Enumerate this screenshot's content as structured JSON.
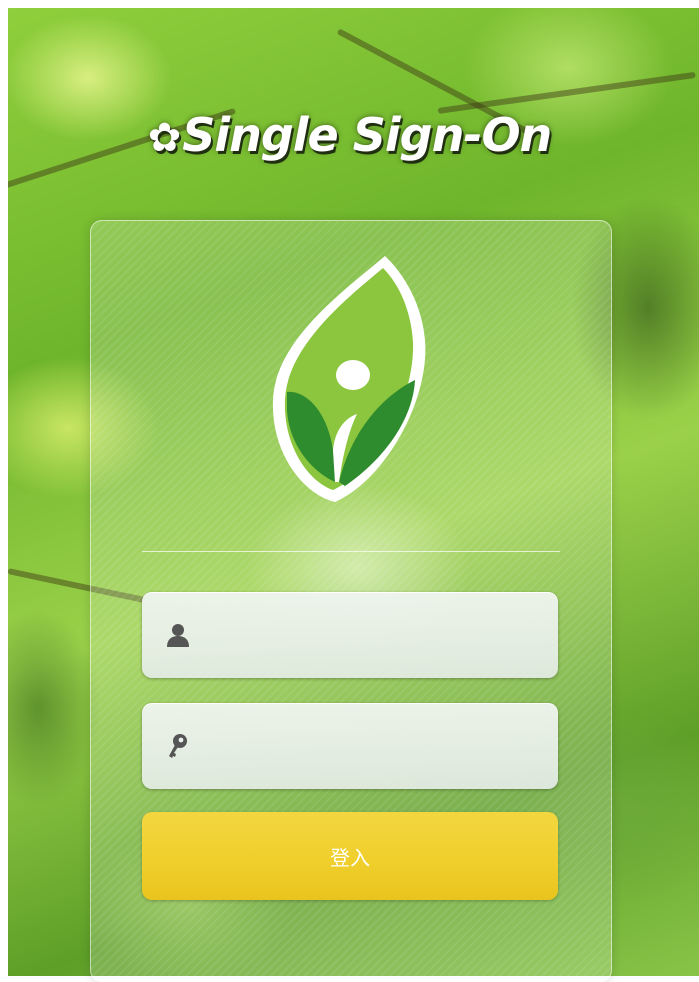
{
  "header": {
    "gear_icon": "gear-icon",
    "title": "Single Sign-On"
  },
  "logo": {
    "icon": "leaf-person-logo",
    "colors": {
      "leaf_light": "#8cc63f",
      "leaf_dark": "#2e8b2e",
      "outline": "#ffffff"
    }
  },
  "login_form": {
    "username": {
      "icon": "user-icon",
      "value": "",
      "placeholder": ""
    },
    "password": {
      "icon": "key-icon",
      "value": "",
      "placeholder": ""
    },
    "submit_label": "登入"
  },
  "colors": {
    "button": "#f0cf2c",
    "button_text": "#ffffff",
    "field_bg": "#ebf1ec",
    "background_green": "#7cbd34"
  }
}
